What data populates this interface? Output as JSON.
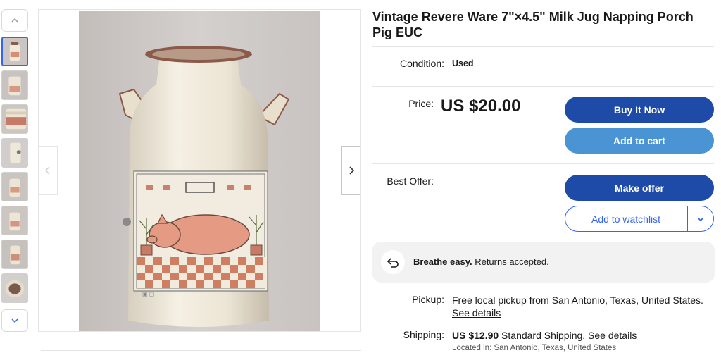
{
  "listing": {
    "title": "Vintage Revere Ware 7\"×4.5\" Milk Jug Napping Porch Pig EUC"
  },
  "condition": {
    "label": "Condition:",
    "value": "Used"
  },
  "price": {
    "label": "Price:",
    "value": "US $20.00"
  },
  "buttons": {
    "buy_now": "Buy It Now",
    "add_to_cart": "Add to cart",
    "make_offer": "Make offer",
    "add_to_watchlist": "Add to watchlist"
  },
  "best_offer": {
    "label": "Best Offer:"
  },
  "returns": {
    "strong": "Breathe easy.",
    "text": " Returns accepted."
  },
  "pickup": {
    "label": "Pickup:",
    "text": "Free local pickup from San Antonio, Texas, United States.",
    "link": "See details"
  },
  "shipping": {
    "label": "Shipping:",
    "price": "US $12.90",
    "method": " Standard Shipping. ",
    "link": "See details",
    "location": "Located in: San Antonio, Texas, United States"
  },
  "thumbnails": {
    "count": 8,
    "active_index": 0
  },
  "icons": {
    "thumb_up": "chevron-up-icon",
    "thumb_down": "chevron-down-icon",
    "image_prev": "chevron-left-icon",
    "image_next": "chevron-right-icon",
    "returns": "return-arrow-icon",
    "watch_menu": "chevron-down-icon"
  },
  "colors": {
    "primary_button": "#1e4aa8",
    "secondary_button": "#4b94d3",
    "accent_blue": "#3665f3"
  }
}
